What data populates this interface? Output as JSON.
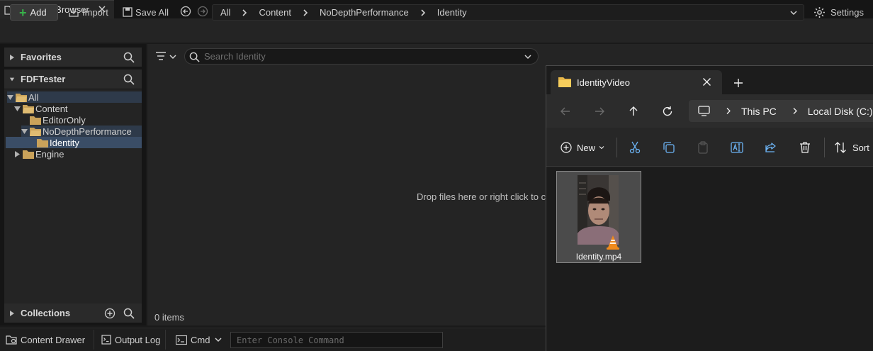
{
  "window": {
    "tab_title": "Content Browser"
  },
  "toolbar": {
    "add_label": "Add",
    "import_label": "Import",
    "save_all_label": "Save All",
    "settings_label": "Settings",
    "breadcrumb": [
      "All",
      "Content",
      "NoDepthPerformance",
      "Identity"
    ]
  },
  "sidebar": {
    "favorites_title": "Favorites",
    "project_title": "FDFTester",
    "collections_title": "Collections",
    "tree": [
      {
        "label": "All",
        "depth": 0,
        "expanded": true,
        "selected": false,
        "highlight": true
      },
      {
        "label": "Content",
        "depth": 1,
        "expanded": true,
        "selected": false,
        "highlight": false
      },
      {
        "label": "EditorOnly",
        "depth": 2,
        "expanded": false,
        "selected": false,
        "highlight": false
      },
      {
        "label": "NoDepthPerformance",
        "depth": 2,
        "expanded": true,
        "selected": false,
        "highlight": true
      },
      {
        "label": "Identity",
        "depth": 3,
        "expanded": false,
        "selected": true,
        "highlight": false
      },
      {
        "label": "Engine",
        "depth": 1,
        "expanded": false,
        "selected": false,
        "highlight": false,
        "collapsed_arrow": true
      }
    ]
  },
  "content": {
    "search_placeholder": "Search Identity",
    "drop_hint": "Drop files here or right click to c",
    "item_count": "0 items"
  },
  "bottombar": {
    "content_drawer": "Content Drawer",
    "output_log": "Output Log",
    "cmd_label": "Cmd",
    "console_placeholder": "Enter Console Command"
  },
  "explorer": {
    "tab_title": "IdentityVideo",
    "address": [
      "This PC",
      "Local Disk (C:)"
    ],
    "new_label": "New",
    "sort_label": "Sort",
    "file_name": "Identity.mp4"
  },
  "colors": {
    "accent_green": "#37b34a",
    "folder": "#c9a25a",
    "selection": "#3a4d66",
    "highlight": "#2e3a4a"
  }
}
